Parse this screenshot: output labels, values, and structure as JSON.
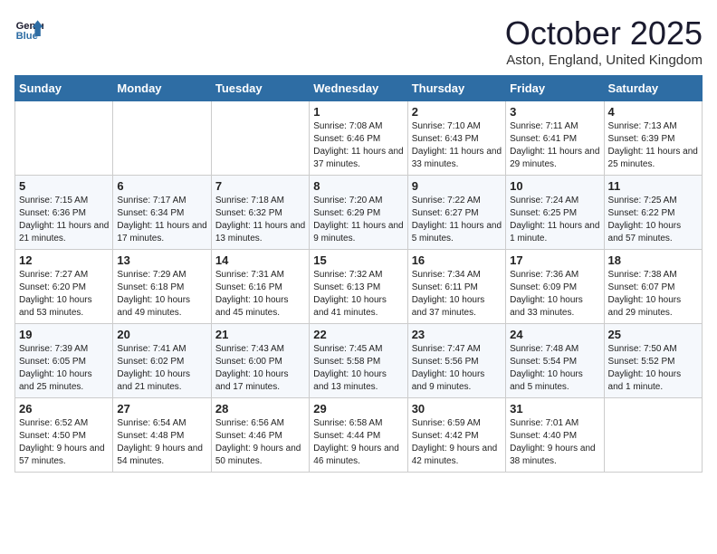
{
  "header": {
    "logo_line1": "General",
    "logo_line2": "Blue",
    "month": "October 2025",
    "location": "Aston, England, United Kingdom"
  },
  "weekdays": [
    "Sunday",
    "Monday",
    "Tuesday",
    "Wednesday",
    "Thursday",
    "Friday",
    "Saturday"
  ],
  "weeks": [
    [
      {
        "day": "",
        "info": ""
      },
      {
        "day": "",
        "info": ""
      },
      {
        "day": "",
        "info": ""
      },
      {
        "day": "1",
        "info": "Sunrise: 7:08 AM\nSunset: 6:46 PM\nDaylight: 11 hours and 37 minutes."
      },
      {
        "day": "2",
        "info": "Sunrise: 7:10 AM\nSunset: 6:43 PM\nDaylight: 11 hours and 33 minutes."
      },
      {
        "day": "3",
        "info": "Sunrise: 7:11 AM\nSunset: 6:41 PM\nDaylight: 11 hours and 29 minutes."
      },
      {
        "day": "4",
        "info": "Sunrise: 7:13 AM\nSunset: 6:39 PM\nDaylight: 11 hours and 25 minutes."
      }
    ],
    [
      {
        "day": "5",
        "info": "Sunrise: 7:15 AM\nSunset: 6:36 PM\nDaylight: 11 hours and 21 minutes."
      },
      {
        "day": "6",
        "info": "Sunrise: 7:17 AM\nSunset: 6:34 PM\nDaylight: 11 hours and 17 minutes."
      },
      {
        "day": "7",
        "info": "Sunrise: 7:18 AM\nSunset: 6:32 PM\nDaylight: 11 hours and 13 minutes."
      },
      {
        "day": "8",
        "info": "Sunrise: 7:20 AM\nSunset: 6:29 PM\nDaylight: 11 hours and 9 minutes."
      },
      {
        "day": "9",
        "info": "Sunrise: 7:22 AM\nSunset: 6:27 PM\nDaylight: 11 hours and 5 minutes."
      },
      {
        "day": "10",
        "info": "Sunrise: 7:24 AM\nSunset: 6:25 PM\nDaylight: 11 hours and 1 minute."
      },
      {
        "day": "11",
        "info": "Sunrise: 7:25 AM\nSunset: 6:22 PM\nDaylight: 10 hours and 57 minutes."
      }
    ],
    [
      {
        "day": "12",
        "info": "Sunrise: 7:27 AM\nSunset: 6:20 PM\nDaylight: 10 hours and 53 minutes."
      },
      {
        "day": "13",
        "info": "Sunrise: 7:29 AM\nSunset: 6:18 PM\nDaylight: 10 hours and 49 minutes."
      },
      {
        "day": "14",
        "info": "Sunrise: 7:31 AM\nSunset: 6:16 PM\nDaylight: 10 hours and 45 minutes."
      },
      {
        "day": "15",
        "info": "Sunrise: 7:32 AM\nSunset: 6:13 PM\nDaylight: 10 hours and 41 minutes."
      },
      {
        "day": "16",
        "info": "Sunrise: 7:34 AM\nSunset: 6:11 PM\nDaylight: 10 hours and 37 minutes."
      },
      {
        "day": "17",
        "info": "Sunrise: 7:36 AM\nSunset: 6:09 PM\nDaylight: 10 hours and 33 minutes."
      },
      {
        "day": "18",
        "info": "Sunrise: 7:38 AM\nSunset: 6:07 PM\nDaylight: 10 hours and 29 minutes."
      }
    ],
    [
      {
        "day": "19",
        "info": "Sunrise: 7:39 AM\nSunset: 6:05 PM\nDaylight: 10 hours and 25 minutes."
      },
      {
        "day": "20",
        "info": "Sunrise: 7:41 AM\nSunset: 6:02 PM\nDaylight: 10 hours and 21 minutes."
      },
      {
        "day": "21",
        "info": "Sunrise: 7:43 AM\nSunset: 6:00 PM\nDaylight: 10 hours and 17 minutes."
      },
      {
        "day": "22",
        "info": "Sunrise: 7:45 AM\nSunset: 5:58 PM\nDaylight: 10 hours and 13 minutes."
      },
      {
        "day": "23",
        "info": "Sunrise: 7:47 AM\nSunset: 5:56 PM\nDaylight: 10 hours and 9 minutes."
      },
      {
        "day": "24",
        "info": "Sunrise: 7:48 AM\nSunset: 5:54 PM\nDaylight: 10 hours and 5 minutes."
      },
      {
        "day": "25",
        "info": "Sunrise: 7:50 AM\nSunset: 5:52 PM\nDaylight: 10 hours and 1 minute."
      }
    ],
    [
      {
        "day": "26",
        "info": "Sunrise: 6:52 AM\nSunset: 4:50 PM\nDaylight: 9 hours and 57 minutes."
      },
      {
        "day": "27",
        "info": "Sunrise: 6:54 AM\nSunset: 4:48 PM\nDaylight: 9 hours and 54 minutes."
      },
      {
        "day": "28",
        "info": "Sunrise: 6:56 AM\nSunset: 4:46 PM\nDaylight: 9 hours and 50 minutes."
      },
      {
        "day": "29",
        "info": "Sunrise: 6:58 AM\nSunset: 4:44 PM\nDaylight: 9 hours and 46 minutes."
      },
      {
        "day": "30",
        "info": "Sunrise: 6:59 AM\nSunset: 4:42 PM\nDaylight: 9 hours and 42 minutes."
      },
      {
        "day": "31",
        "info": "Sunrise: 7:01 AM\nSunset: 4:40 PM\nDaylight: 9 hours and 38 minutes."
      },
      {
        "day": "",
        "info": ""
      }
    ]
  ]
}
